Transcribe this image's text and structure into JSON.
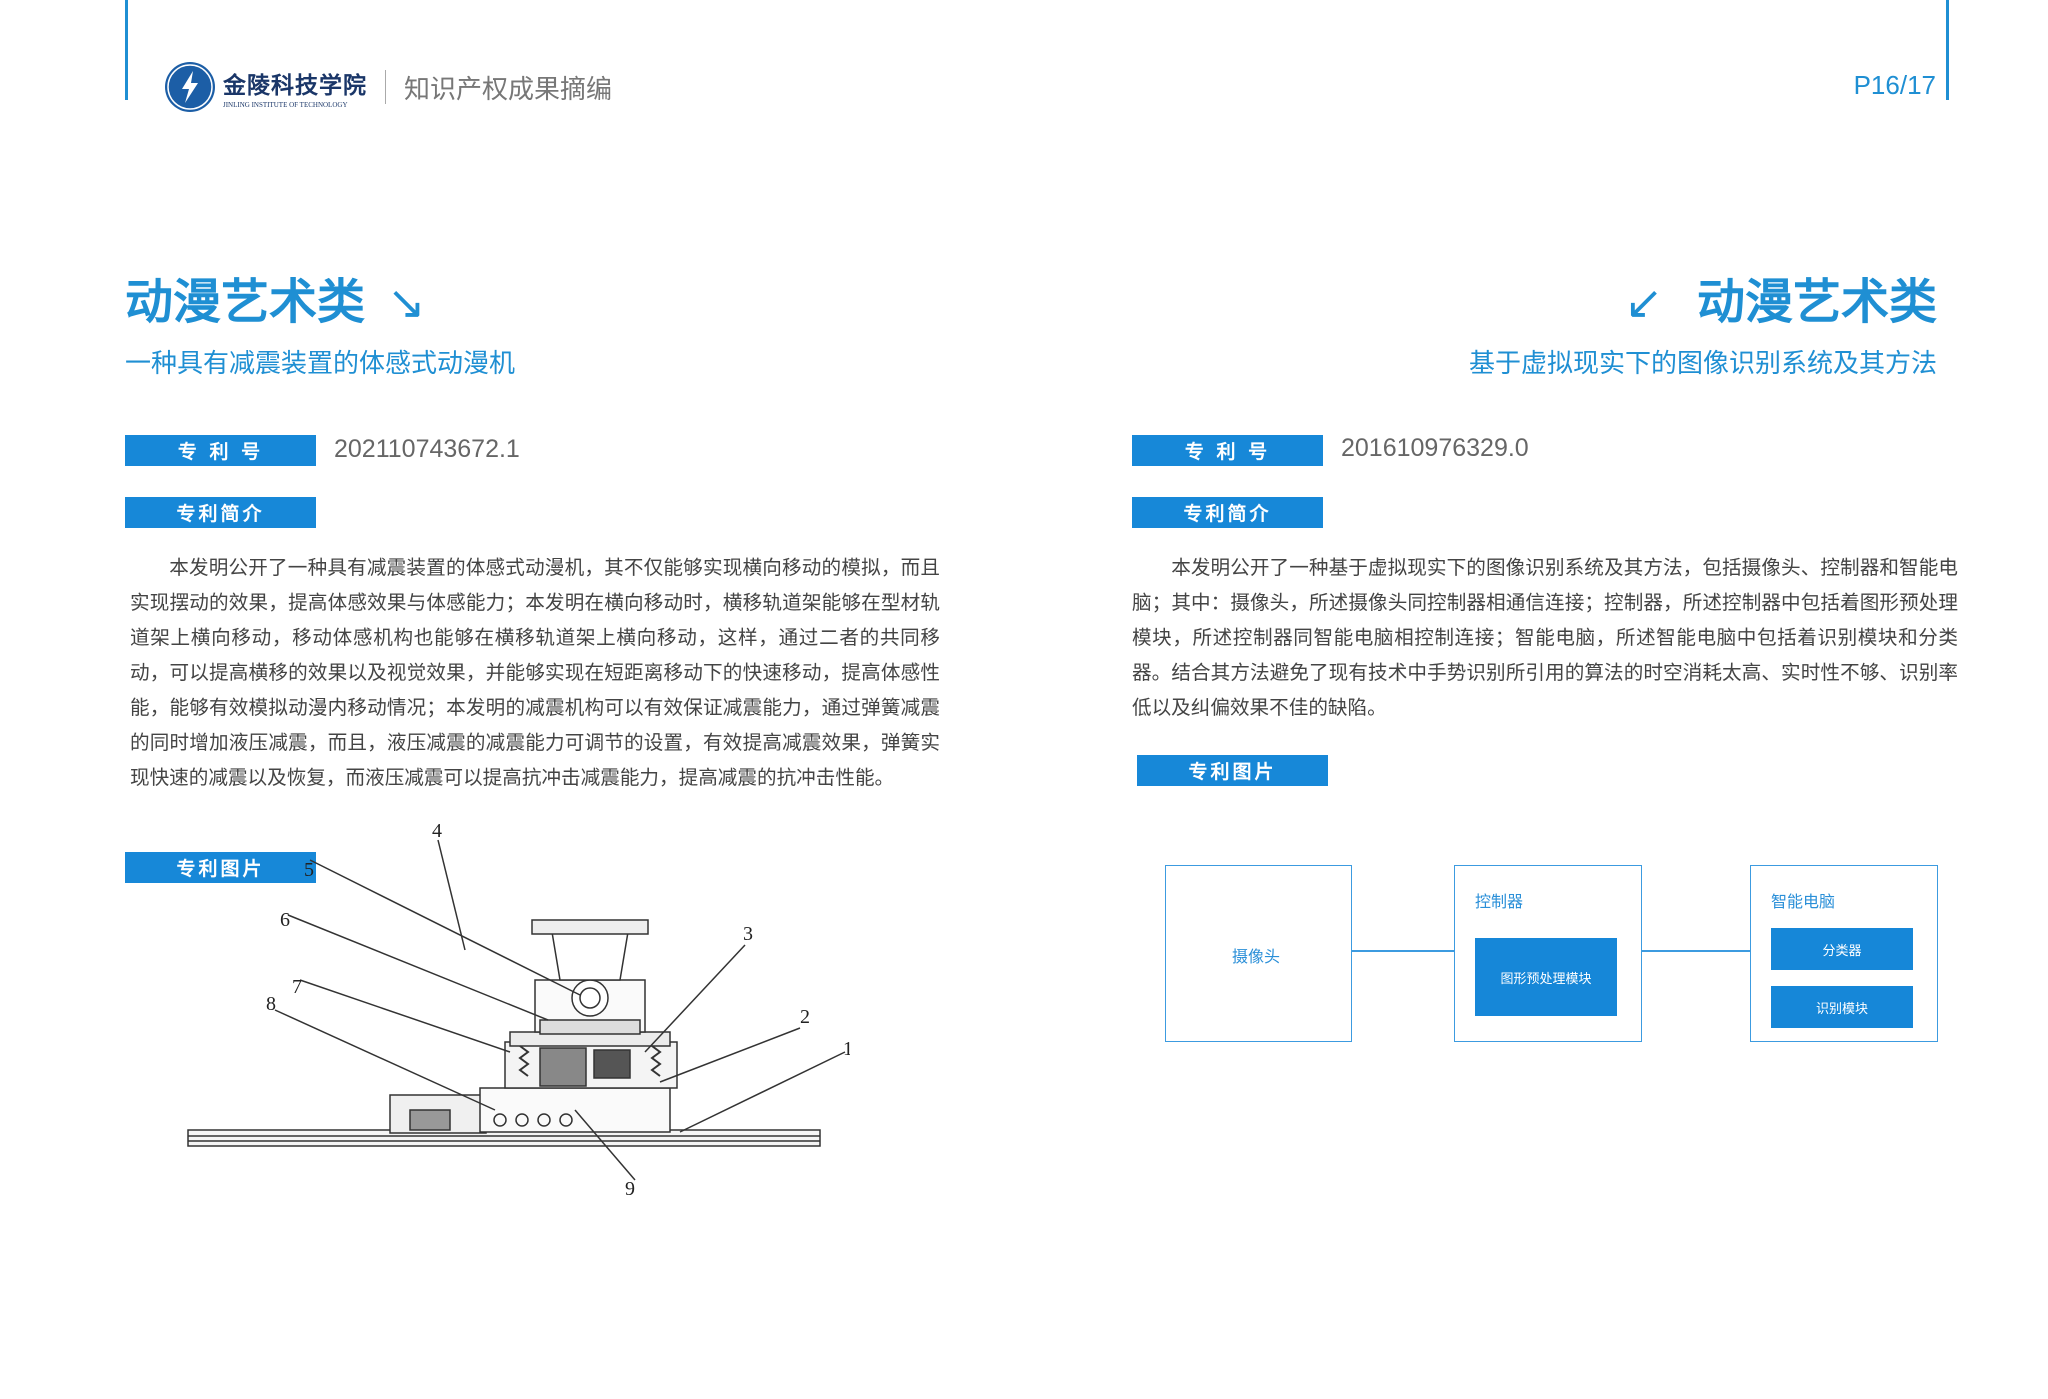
{
  "header": {
    "logo_cn": "金陵科技学院",
    "logo_en": "JINLING INSTITUTE OF TECHNOLOGY",
    "doc_title": "知识产权成果摘编",
    "page_number": "P16/17"
  },
  "left": {
    "category": "动漫艺术类",
    "category_arrow": "↘",
    "subtitle": "一种具有减震装置的体感式动漫机",
    "patent_no_label": "专 利 号",
    "patent_no": "202110743672.1",
    "intro_label": "专利简介",
    "intro_text": "本发明公开了一种具有减震装置的体感式动漫机，其不仅能够实现横向移动的模拟，而且实现摆动的效果，提高体感效果与体感能力；本发明在横向移动时，横移轨道架能够在型材轨道架上横向移动，移动体感机构也能够在横移轨道架上横向移动，这样，通过二者的共同移动，可以提高横移的效果以及视觉效果，并能够实现在短距离移动下的快速移动，提高体感性能，能够有效模拟动漫内移动情况；本发明的减震机构可以有效保证减震能力，通过弹簧减震的同时增加液压减震，而且，液压减震的减震能力可调节的设置，有效提高减震效果，弹簧实现快速的减震以及恢复，而液压减震可以提高抗冲击减震能力，提高减震的抗冲击性能。",
    "figure_label": "专利图片",
    "figure_callouts": [
      "1",
      "2",
      "3",
      "4",
      "5",
      "6",
      "7",
      "8",
      "9"
    ]
  },
  "right": {
    "category": "动漫艺术类",
    "category_arrow": "↙",
    "subtitle": "基于虚拟现实下的图像识别系统及其方法",
    "patent_no_label": "专 利 号",
    "patent_no": "201610976329.0",
    "intro_label": "专利简介",
    "intro_text": "本发明公开了一种基于虚拟现实下的图像识别系统及其方法，包括摄像头、控制器和智能电脑；其中：摄像头，所述摄像头同控制器相通信连接；控制器，所述控制器中包括着图形预处理模块，所述控制器同智能电脑相控制连接；智能电脑，所述智能电脑中包括着识别模块和分类器。结合其方法避免了现有技术中手势识别所引用的算法的时空消耗太高、实时性不够、识别率低以及纠偏效果不佳的缺陷。",
    "figure_label": "专利图片",
    "diagram": {
      "camera": "摄像头",
      "controller": "控制器",
      "preprocess": "图形预处理模块",
      "computer": "智能电脑",
      "classifier": "分类器",
      "recognizer": "识别模块"
    }
  },
  "colors": {
    "accent": "#1f8fd3",
    "tag_bg": "#1788d8",
    "logo": "#1c5ea6"
  }
}
